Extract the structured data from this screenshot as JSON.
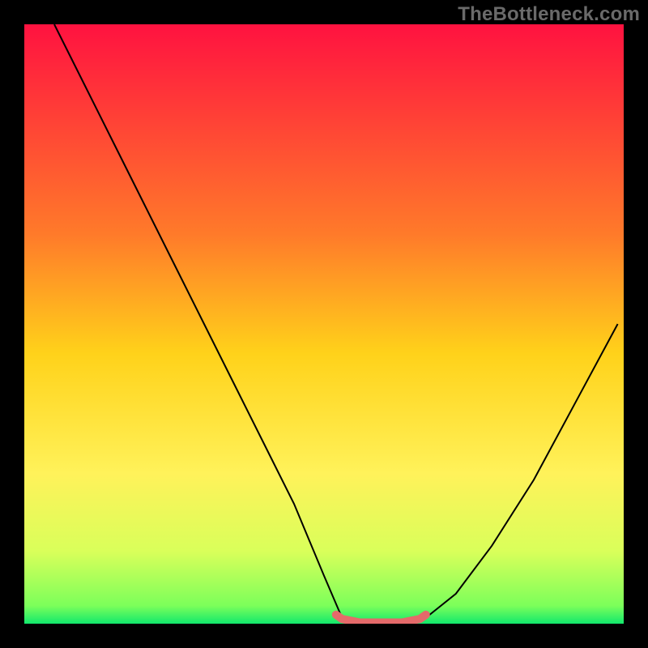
{
  "watermark": "TheBottleneck.com",
  "chart_data": {
    "type": "line",
    "title": "",
    "xlabel": "",
    "ylabel": "",
    "xlim": [
      0,
      100
    ],
    "ylim": [
      0,
      100
    ],
    "grid": false,
    "legend": false,
    "background_gradient_stops": [
      {
        "offset": 0,
        "color": "#ff1240"
      },
      {
        "offset": 35,
        "color": "#ff7a2a"
      },
      {
        "offset": 55,
        "color": "#ffd21a"
      },
      {
        "offset": 75,
        "color": "#fff25a"
      },
      {
        "offset": 88,
        "color": "#d9ff5a"
      },
      {
        "offset": 97,
        "color": "#7cff5a"
      },
      {
        "offset": 100,
        "color": "#12e86c"
      }
    ],
    "series": [
      {
        "name": "bottleneck-curve",
        "stroke": "#000000",
        "stroke_width": 2,
        "x": [
          5,
          10,
          15,
          20,
          25,
          30,
          35,
          40,
          45,
          50,
          53,
          56,
          60,
          63,
          67,
          72,
          78,
          85,
          92,
          99
        ],
        "values": [
          100,
          90,
          80,
          70,
          60,
          50,
          40,
          30,
          20,
          8,
          1,
          0,
          0,
          0,
          1,
          5,
          13,
          24,
          37,
          50
        ]
      },
      {
        "name": "optimal-range",
        "stroke": "#e46a6a",
        "stroke_width": 10,
        "linecap": "round",
        "x": [
          52,
          53,
          56,
          60,
          63,
          66,
          67
        ],
        "values": [
          1.5,
          0.8,
          0.2,
          0.2,
          0.2,
          0.8,
          1.5
        ]
      }
    ]
  }
}
